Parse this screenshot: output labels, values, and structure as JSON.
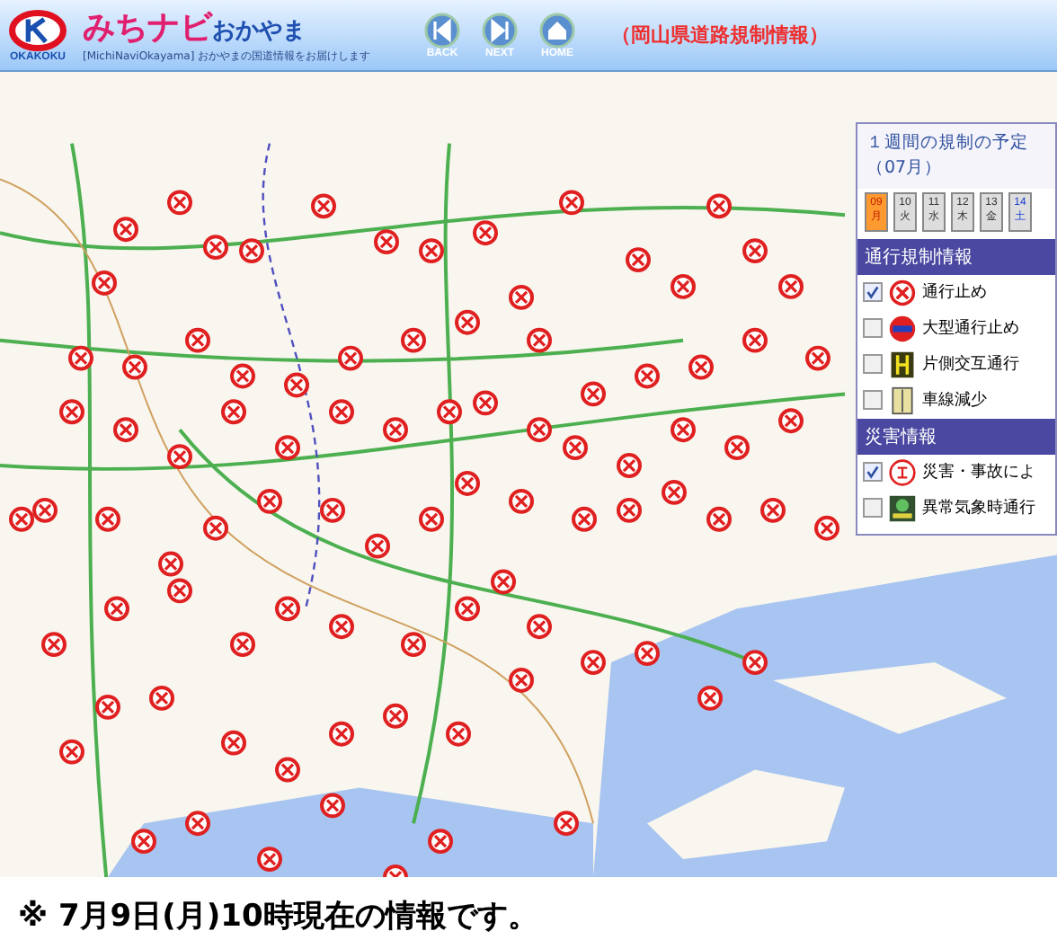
{
  "header": {
    "logo_text": "OKAKOKU",
    "brand_main": "みちナビ",
    "brand_sub": "おかやま",
    "tagline": "[MichiNaviOkayama] おかやまの国道情報をお届けします",
    "nav_buttons": [
      {
        "kind": "back",
        "label": "BACK"
      },
      {
        "kind": "next",
        "label": "NEXT"
      },
      {
        "kind": "home",
        "label": "HOME"
      }
    ],
    "page_title": "（岡山県道路規制情報）"
  },
  "schedule_panel": {
    "title": "１週間の規制の予定（07月）",
    "days": [
      {
        "day": "09",
        "weekday": "月",
        "selected": true,
        "kind": "weekday"
      },
      {
        "day": "10",
        "weekday": "火",
        "selected": false,
        "kind": "weekday"
      },
      {
        "day": "11",
        "weekday": "水",
        "selected": false,
        "kind": "weekday"
      },
      {
        "day": "12",
        "weekday": "木",
        "selected": false,
        "kind": "weekday"
      },
      {
        "day": "13",
        "weekday": "金",
        "selected": false,
        "kind": "weekday"
      },
      {
        "day": "14",
        "weekday": "土",
        "selected": false,
        "kind": "saturday"
      }
    ],
    "sections": [
      {
        "title": "通行規制情報",
        "items": [
          {
            "label": "通行止め",
            "checked": true,
            "kind": "closure"
          },
          {
            "label": "大型通行止め",
            "checked": false,
            "kind": "large-vehicle"
          },
          {
            "label": "片側交互通行",
            "checked": false,
            "kind": "alternating"
          },
          {
            "label": "車線減少",
            "checked": false,
            "kind": "lane"
          }
        ]
      },
      {
        "title": "災害情報",
        "items": [
          {
            "label": "災害・事故によ",
            "checked": true,
            "kind": "disaster"
          },
          {
            "label": "異常気象時通行",
            "checked": false,
            "kind": "weather"
          }
        ]
      }
    ]
  },
  "footer_note": "※ 7月9日(月)10時現在の情報です。"
}
